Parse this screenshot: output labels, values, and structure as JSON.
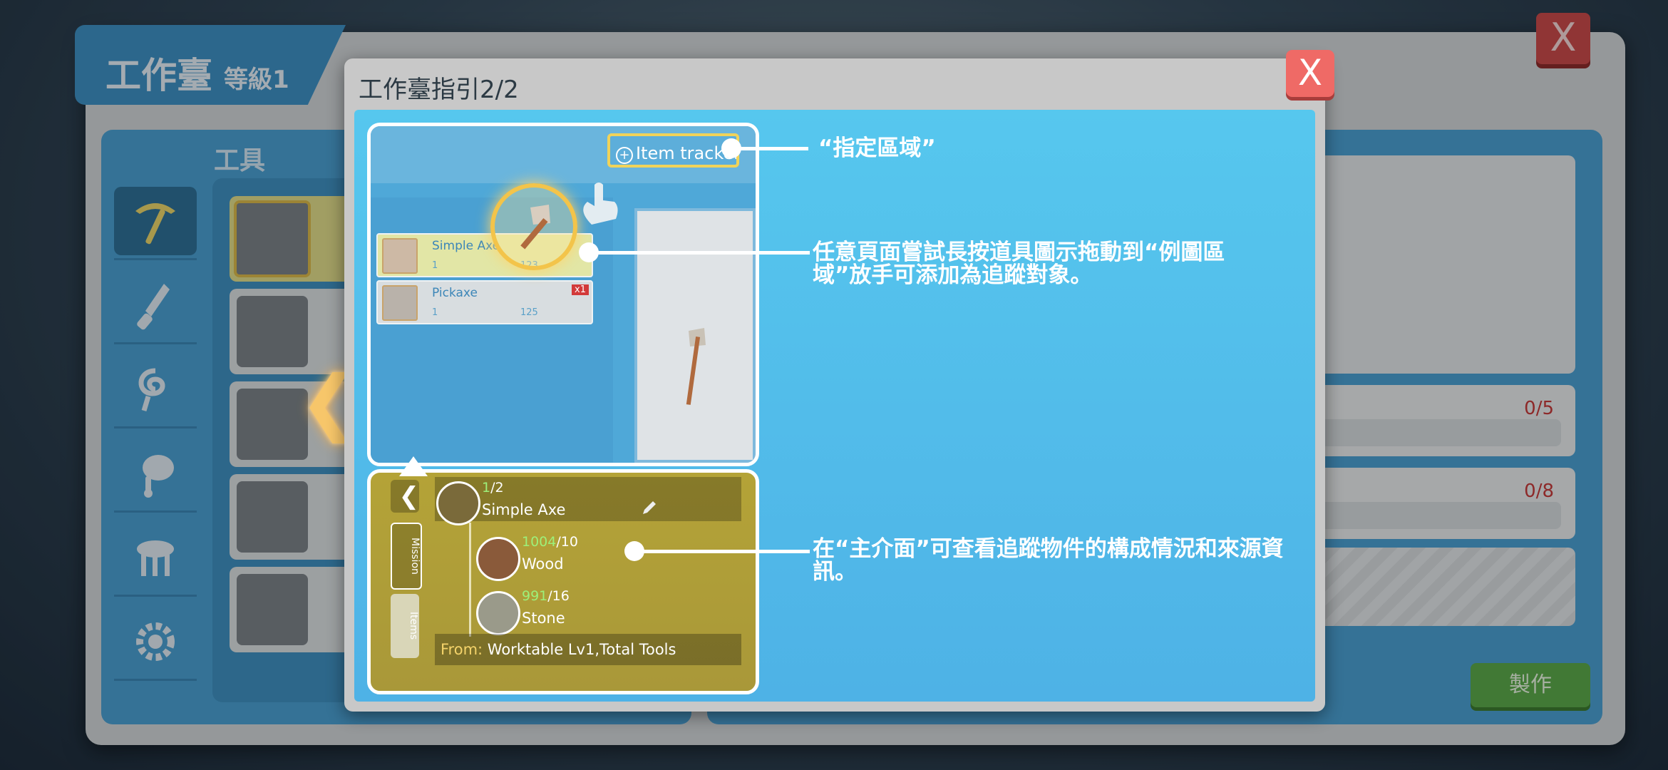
{
  "workbench": {
    "title": "工作臺",
    "level": "等級1",
    "close_label": "X",
    "tools_label": "工具",
    "req_counts": [
      "0/5",
      "0/8"
    ],
    "make_label": "製作",
    "categories": [
      "pickaxe-icon",
      "dagger-icon",
      "rope-icon",
      "meat-icon",
      "stool-icon",
      "gear-icon"
    ]
  },
  "guide": {
    "title": "工作臺指引2/2",
    "close_label": "X",
    "example": {
      "tracker_label": "Item tracker",
      "items": [
        {
          "name": "Simple Axe",
          "stat1": "1",
          "stat2": "123"
        },
        {
          "name": "Pickaxe",
          "stat1": "1",
          "stat2": "125",
          "badge": "x1"
        }
      ],
      "tracked": {
        "count_have": "1",
        "count_need": "/2",
        "name": "Simple Axe",
        "materials": [
          {
            "have": "1004",
            "need": "/10",
            "name": "Wood"
          },
          {
            "have": "991",
            "need": "/16",
            "name": "Stone"
          }
        ],
        "from_label": "From:",
        "from_value": "Worktable Lv1,Total Tools"
      },
      "tabs": [
        "Mission",
        "Items"
      ]
    },
    "annotations": [
      "“指定區域”",
      "任意頁面嘗試長按道具圖示拖動到“例圖區域”放手可添加為追蹤對象。",
      "在“主介面”可查看追蹤物件的構成情況和來源資訊。"
    ]
  }
}
